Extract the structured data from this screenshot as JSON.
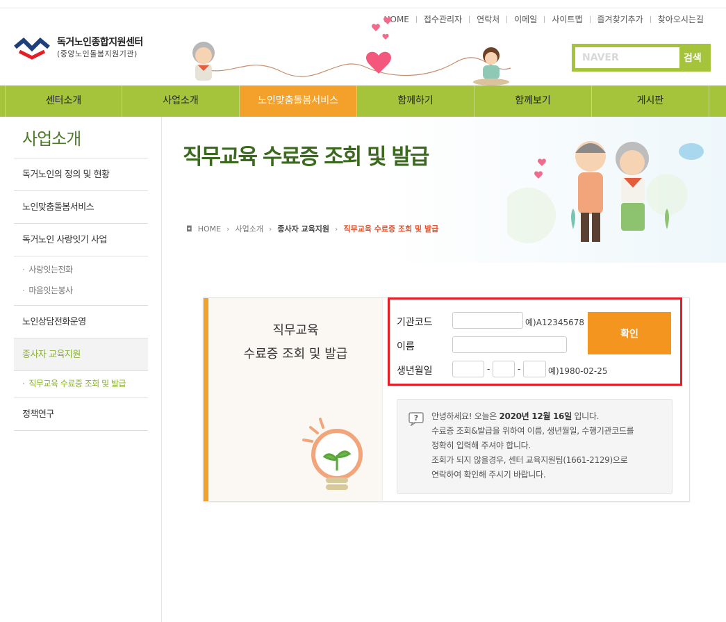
{
  "util_links": [
    "HOME",
    "접수관리자",
    "연락처",
    "이메일",
    "사이트맵",
    "즐겨찾기추가",
    "찾아오시는길"
  ],
  "logo": {
    "line1": "독거노인종합지원센터",
    "line2": "(중앙노인돌봄지원기관)"
  },
  "search": {
    "placeholder": "NAVER",
    "button": "검색"
  },
  "gnb": [
    "센터소개",
    "사업소개",
    "노인맞춤돌봄서비스",
    "함께하기",
    "함께보기",
    "게시판"
  ],
  "lnb": {
    "title": "사업소개",
    "items": [
      "독거노인의 정의 및 현황",
      "노인맞춤돌봄서비스",
      "독거노인 사랑잇기 사업"
    ],
    "sub1": [
      "사랑잇는전화",
      "마음잇는봉사"
    ],
    "item4": "노인상담전화운영",
    "item5": "종사자 교육지원",
    "sub2": [
      "직무교육 수료증 조회 및 발급"
    ],
    "item6": "정책연구"
  },
  "page": {
    "title": "직무교육 수료증 조회 및 발급",
    "breadcrumb": [
      "HOME",
      "사업소개",
      "종사자 교육지원",
      "직무교육 수료증 조회 및 발급"
    ]
  },
  "card": {
    "left_line1": "직무교육",
    "left_line2": "수료증 조회 및 발급",
    "form": {
      "org_code_label": "기관코드",
      "org_code_hint": "예)A12345678",
      "name_label": "이름",
      "birth_label": "생년월일",
      "birth_hint": "예)1980-02-25",
      "confirm": "확인"
    },
    "info": {
      "greeting_pre": "안녕하세요! 오늘은 ",
      "date": "2020년 12월 16일",
      "greeting_post": " 입니다.",
      "line2": "수료증 조회&발급을 위하여 이름, 생년월일, 수행기관코드를",
      "line3": "정확히 입력해 주셔야 합니다.",
      "line4": "조회가 되지 않을경우, 센터 교육지원팀(1661-2129)으로",
      "line5": "연락하여 확인해 주시기 바랍니다."
    }
  },
  "colors": {
    "green": "#a5c43b",
    "orange": "#f3a12a",
    "red": "#e31e26",
    "title_green": "#3b6a1f"
  }
}
